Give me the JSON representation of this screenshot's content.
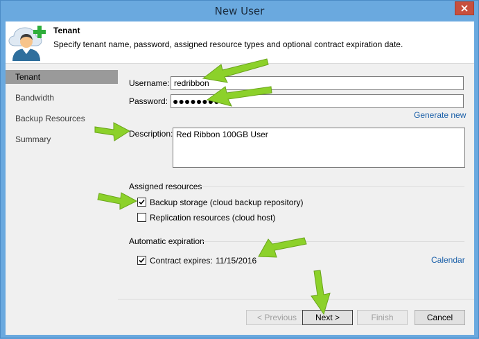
{
  "window": {
    "title": "New User"
  },
  "header": {
    "title": "Tenant",
    "description": "Specify tenant name, password, assigned resource types and optional contract expiration date."
  },
  "nav": {
    "items": [
      {
        "label": "Tenant",
        "active": true
      },
      {
        "label": "Bandwidth",
        "active": false
      },
      {
        "label": "Backup Resources",
        "active": false
      },
      {
        "label": "Summary",
        "active": false
      }
    ]
  },
  "form": {
    "username_label": "Username:",
    "username_value": "redribbon",
    "password_label": "Password:",
    "password_dots": "●●●●●●●●●",
    "generate_link": "Generate new",
    "description_label": "Description:",
    "description_value": "Red Ribbon 100GB User"
  },
  "assigned_resources": {
    "title": "Assigned resources",
    "backup_storage": {
      "label": "Backup storage (cloud backup repository)",
      "checked": true
    },
    "replication": {
      "label": "Replication resources (cloud host)",
      "checked": false
    }
  },
  "expiration": {
    "title": "Automatic expiration",
    "contract_label": "Contract expires:",
    "contract_checked": true,
    "date": "11/15/2016",
    "calendar_link": "Calendar"
  },
  "buttons": {
    "previous": "< Previous",
    "next": "Next >",
    "finish": "Finish",
    "cancel": "Cancel"
  },
  "colors": {
    "title_bar": "#6aa9df",
    "close": "#c74f3e",
    "link": "#1a5fa8",
    "arrow": "#8cd12a"
  }
}
